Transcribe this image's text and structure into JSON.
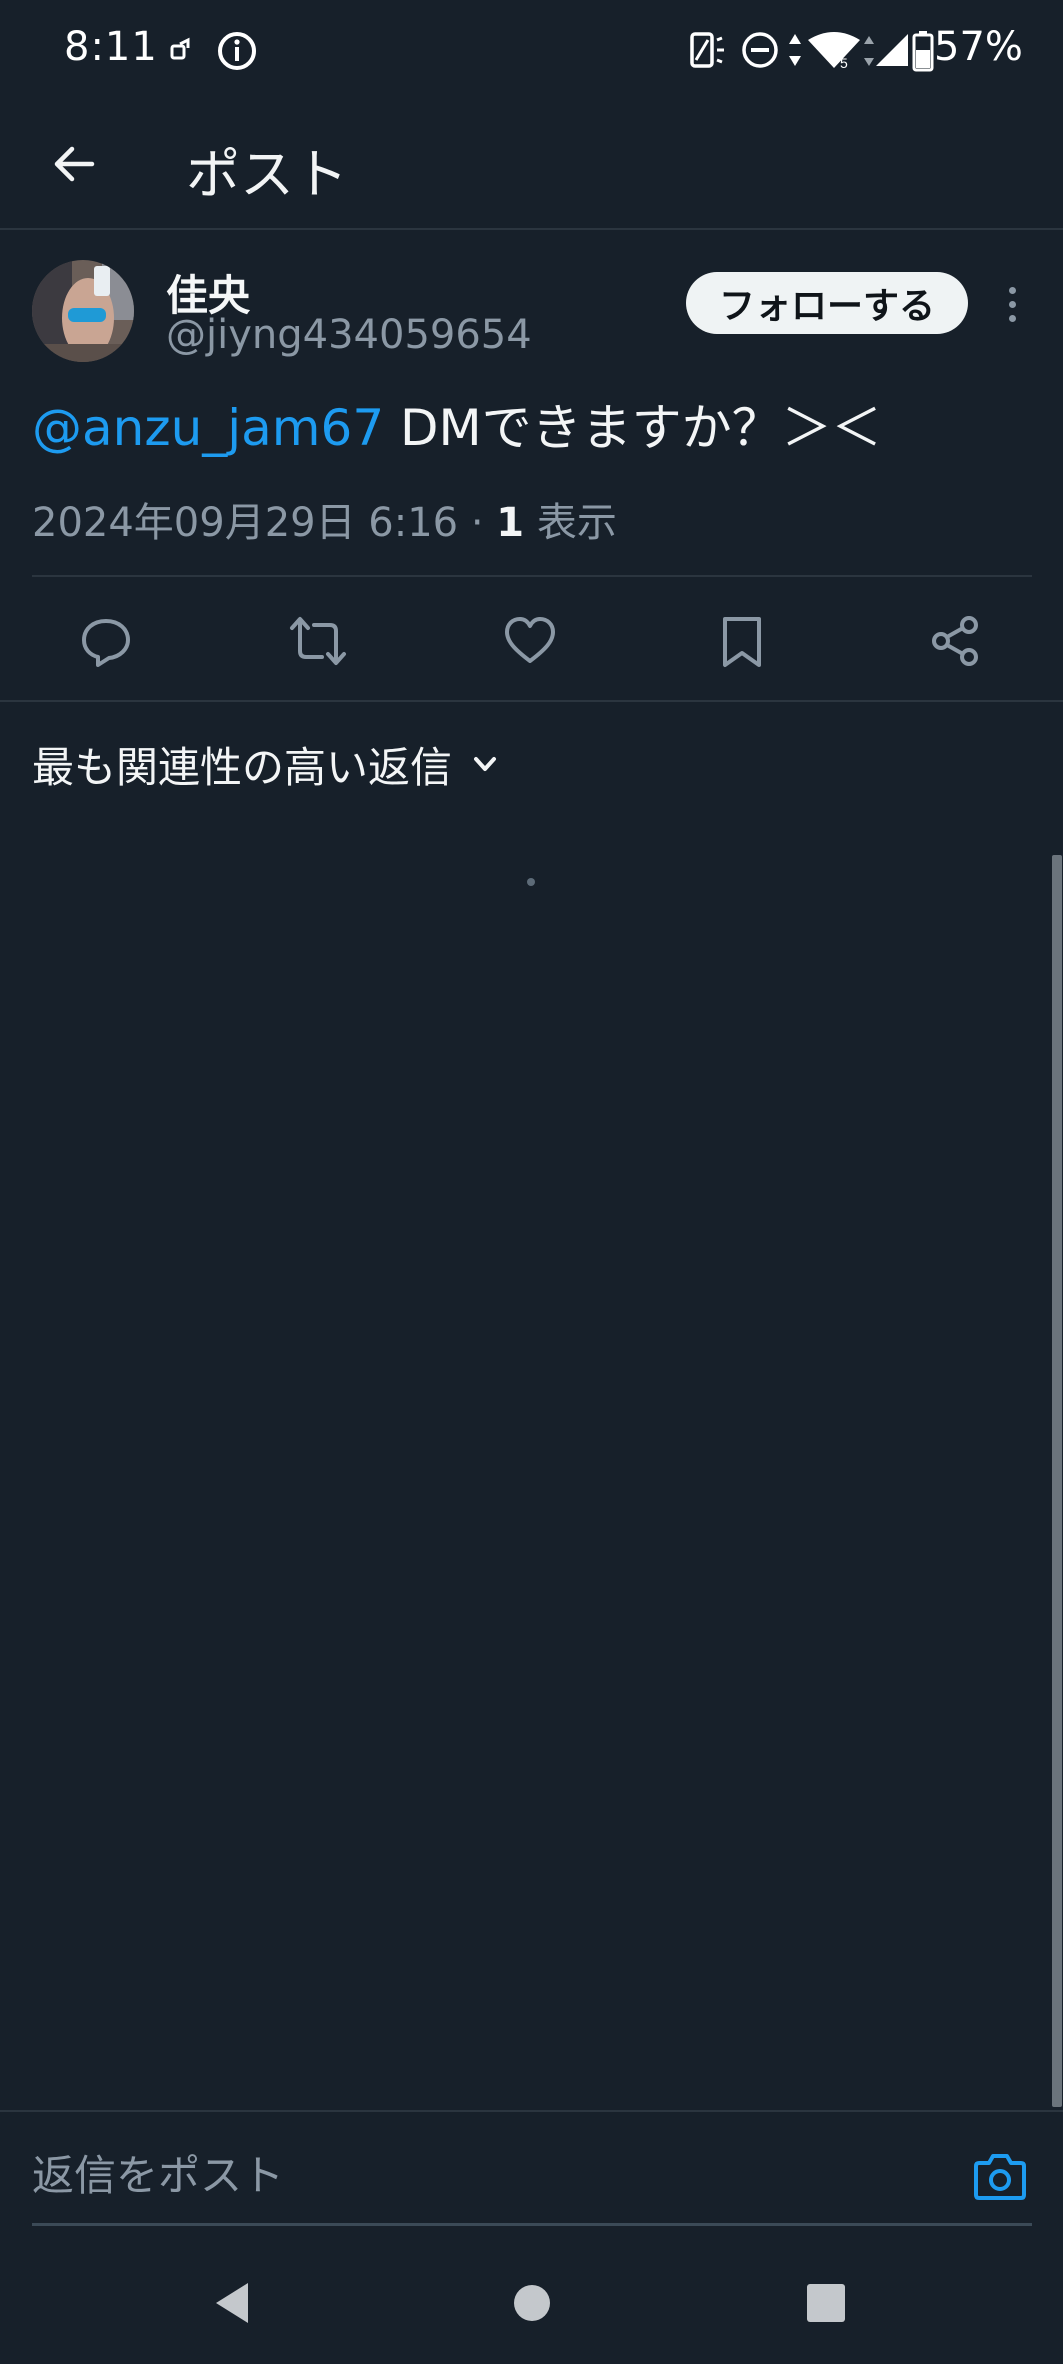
{
  "status_bar": {
    "time": "8:11",
    "battery": "57%",
    "icons": [
      "notification-icon",
      "info-icon",
      "vibrate-icon",
      "dnd-icon",
      "data-arrows-icon",
      "wifi-icon",
      "signal-icon",
      "battery-icon"
    ]
  },
  "header": {
    "title": "ポスト",
    "back_icon": "arrow-left-icon"
  },
  "post": {
    "display_name": "佳央",
    "handle": "@jiyng434059654",
    "follow_label": "フォローする",
    "mention": "@anzu_jam67",
    "text": " DMできますか？＞＜",
    "timestamp": "2024年09月29日 6:16",
    "separator": " · ",
    "view_count": "1",
    "view_label": " 表示"
  },
  "actions": [
    "reply-icon",
    "repost-icon",
    "like-icon",
    "bookmark-icon",
    "share-icon"
  ],
  "replies": {
    "sort_label": "最も関連性の高い返信",
    "sort_icon": "chevron-down-icon"
  },
  "composer": {
    "placeholder": "返信をポスト",
    "camera_icon": "camera-icon"
  },
  "navbar": [
    "back-triangle-icon",
    "home-circle-icon",
    "recents-square-icon"
  ],
  "colors": {
    "background": "#17202a",
    "accent": "#1d9bf0",
    "secondary_text": "#8b98a5",
    "divider": "#2b353f"
  }
}
